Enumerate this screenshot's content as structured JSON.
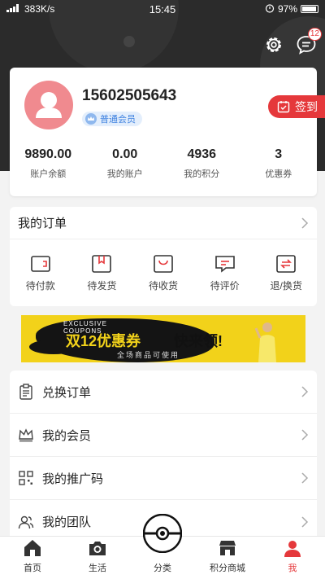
{
  "status_bar": {
    "signal": "📶",
    "network_speed": "383K/s",
    "time": "15:45",
    "battery_percent": "97%"
  },
  "header": {
    "message_badge": "12",
    "icons": [
      "gear-icon",
      "chat-icon"
    ]
  },
  "profile": {
    "phone": "15602505643",
    "member_level": "普通会员",
    "signin_label": "签到",
    "stats": [
      {
        "value": "9890.00",
        "label": "账户余额"
      },
      {
        "value": "0.00",
        "label": "我的账户"
      },
      {
        "value": "4936",
        "label": "我的积分"
      },
      {
        "value": "3",
        "label": "优惠券"
      }
    ]
  },
  "orders": {
    "title": "我的订单",
    "items": [
      {
        "label": "待付款",
        "icon": "wallet-icon"
      },
      {
        "label": "待发货",
        "icon": "package-icon"
      },
      {
        "label": "待收货",
        "icon": "bag-icon"
      },
      {
        "label": "待评价",
        "icon": "comment-icon"
      },
      {
        "label": "退/换货",
        "icon": "exchange-icon"
      }
    ]
  },
  "banner": {
    "english_line1": "EXCLUSIVE",
    "english_line2": "COUPONS",
    "headline": "双12优惠券",
    "headline_right": "快来领!",
    "subtitle": "全场商品可使用"
  },
  "menu": [
    {
      "label": "兑换订单",
      "icon": "clipboard-icon"
    },
    {
      "label": "我的会员",
      "icon": "crown-icon"
    },
    {
      "label": "我的推广码",
      "icon": "qrcode-icon"
    },
    {
      "label": "我的团队",
      "icon": "team-icon"
    }
  ],
  "tabbar": [
    {
      "label": "首页",
      "icon": "home-icon"
    },
    {
      "label": "生活",
      "icon": "camera-icon"
    },
    {
      "label": "分类",
      "icon": "ball-icon"
    },
    {
      "label": "积分商城",
      "icon": "store-icon"
    },
    {
      "label": "我",
      "icon": "user-icon",
      "active": true
    }
  ],
  "colors": {
    "accent": "#e5383b",
    "dark_header": "#2b2b2b",
    "banner_yellow": "#f2d21a"
  }
}
